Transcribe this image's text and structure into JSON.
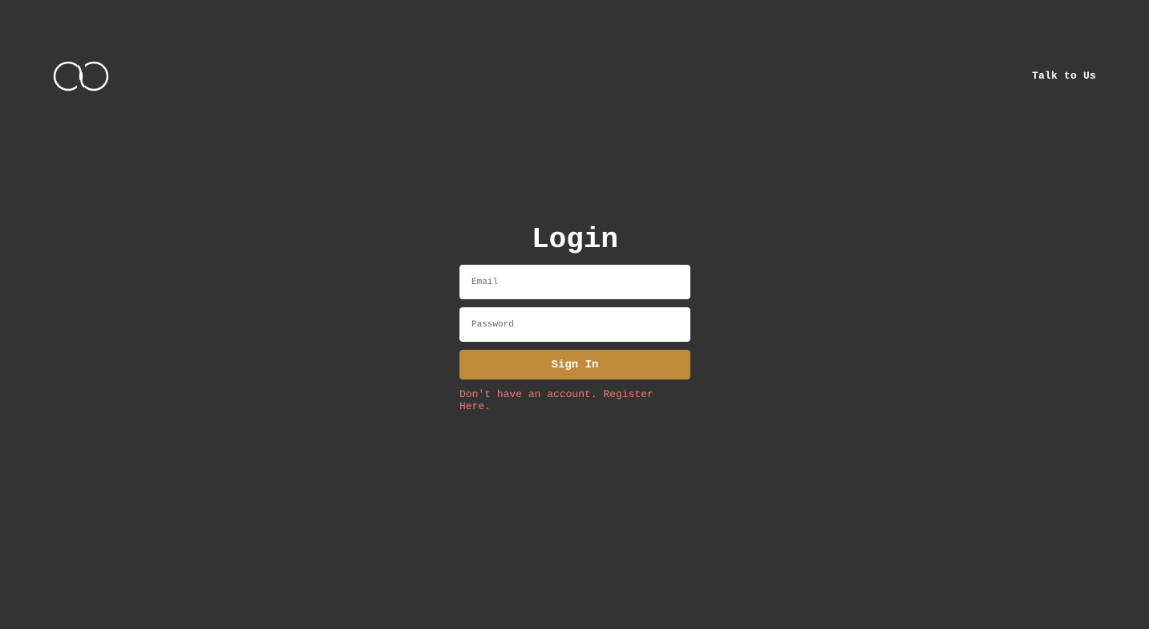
{
  "header": {
    "logo_icon": "infinity-loops-logo",
    "talk_link_label": "Talk to Us"
  },
  "login": {
    "title": "Login",
    "email_placeholder": "Email",
    "email_value": "",
    "password_placeholder": "Password",
    "password_value": "",
    "signin_label": "Sign In",
    "register_text": "Don't have an account. Register Here."
  },
  "colors": {
    "background": "#333333",
    "button": "#bf8a3a",
    "register_link": "#f57a6e",
    "text": "#ffffff"
  }
}
